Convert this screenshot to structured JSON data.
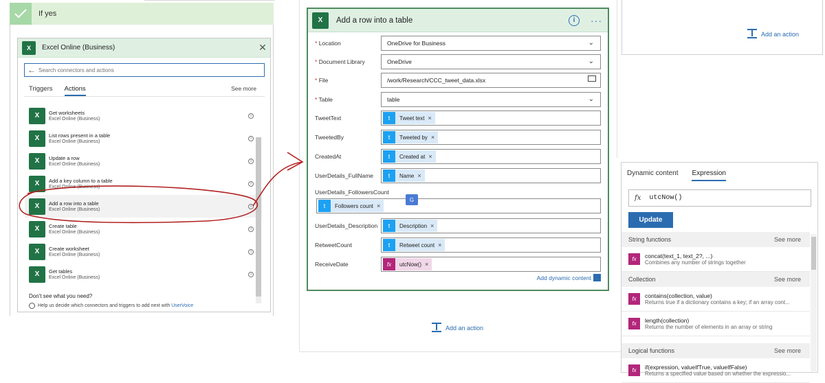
{
  "ifyes": {
    "label": "If yes"
  },
  "picker": {
    "title": "Excel Online (Business)",
    "search_placeholder": "Search connectors and actions",
    "tabs": [
      "Triggers",
      "Actions"
    ],
    "active_tab": "Actions",
    "see_more": "See more",
    "actions": [
      {
        "name": "Get worksheets",
        "sub": "Excel Online (Business)"
      },
      {
        "name": "List rows present in a table",
        "sub": "Excel Online (Business)"
      },
      {
        "name": "Update a row",
        "sub": "Excel Online (Business)"
      },
      {
        "name": "Add a key column to a table",
        "sub": "Excel Online (Business)"
      },
      {
        "name": "Add a row into a table",
        "sub": "Excel Online (Business)"
      },
      {
        "name": "Create table",
        "sub": "Excel Online (Business)"
      },
      {
        "name": "Create worksheet",
        "sub": "Excel Online (Business)"
      },
      {
        "name": "Get tables",
        "sub": "Excel Online (Business)"
      }
    ],
    "dont_see": "Don't see what you need?",
    "help_text": "Help us decide which connectors and triggers to add next with",
    "help_link": "UserVoice"
  },
  "card": {
    "title": "Add a row into a table",
    "fields": {
      "location": {
        "label": "Location",
        "value": "OneDrive for Business"
      },
      "doclib": {
        "label": "Document Library",
        "value": "OneDrive"
      },
      "file": {
        "label": "File",
        "value": "/work/Research/CCC_tweet_data.xlsx"
      },
      "table": {
        "label": "Table",
        "value": "table"
      },
      "tweettext": {
        "label": "TweetText",
        "token": "Tweet text"
      },
      "tweetedby": {
        "label": "TweetedBy",
        "token": "Tweeted by"
      },
      "createdat": {
        "label": "CreatedAt",
        "token": "Created at"
      },
      "fullname": {
        "label": "UserDetails_FullName",
        "token": "Name"
      },
      "followers": {
        "label": "UserDetails_FollowersCount",
        "token": "Followers count"
      },
      "description": {
        "label": "UserDetails_Description",
        "token": "Description"
      },
      "retweet": {
        "label": "RetweetCount",
        "token": "Retweet count"
      },
      "receivedate": {
        "label": "ReceiveDate",
        "token": "utcNow()"
      }
    },
    "add_dynamic": "Add dynamic content"
  },
  "add_action": "Add an action",
  "expression_panel": {
    "tabs": [
      "Dynamic content",
      "Expression"
    ],
    "active_tab": "Expression",
    "input_value": "utcNow()",
    "update_label": "Update",
    "groups": [
      {
        "title": "String functions",
        "more": "See more",
        "items": [
          {
            "name": "concat(text_1, text_2?, ...)",
            "desc": "Combines any number of strings together"
          }
        ]
      },
      {
        "title": "Collection",
        "more": "See more",
        "items": [
          {
            "name": "contains(collection, value)",
            "desc": "Returns true if a dictionary contains a key; if an array cont..."
          },
          {
            "name": "length(collection)",
            "desc": "Returns the number of elements in an array or string"
          }
        ]
      },
      {
        "title": "Logical functions",
        "more": "See more",
        "items": [
          {
            "name": "if(expression, valueIfTrue, valueIfFalse)",
            "desc": "Returns a specified value based on whether the expressio..."
          }
        ]
      }
    ]
  },
  "colors": {
    "accent": "#2b6cb0",
    "excel": "#217346",
    "twitter": "#1da1f2",
    "expr": "#b3267a",
    "annotation": "#b22222"
  },
  "icons": {
    "excel": "excel-icon",
    "twitter": "twitter-icon",
    "function": "fx-icon",
    "info": "info-icon"
  }
}
